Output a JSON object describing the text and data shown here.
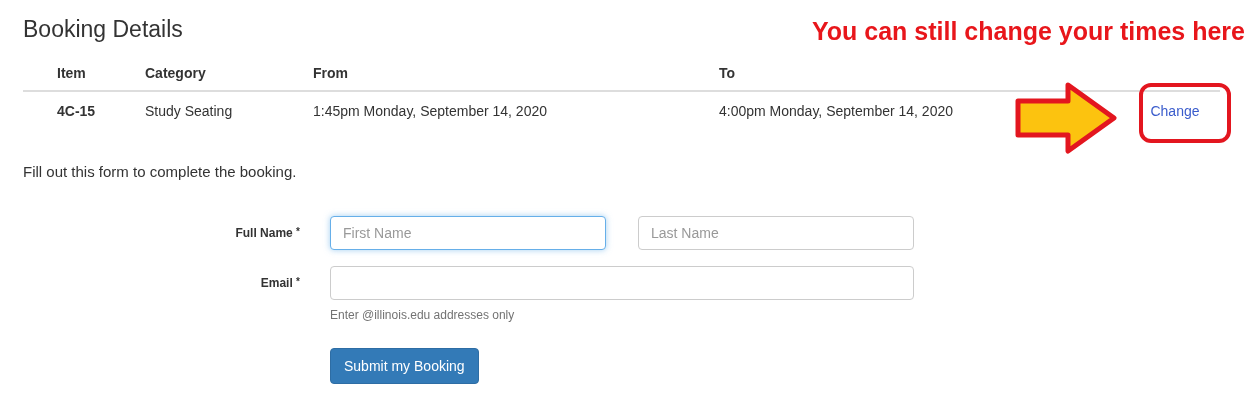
{
  "heading": "Booking Details",
  "annotation": {
    "callout": "You can still change your times here"
  },
  "table": {
    "columns": [
      "Item",
      "Category",
      "From",
      "To"
    ],
    "rows": [
      {
        "cells": [
          "4C-15",
          "Study Seating",
          "1:45pm Monday, September 14, 2020",
          "4:00pm Monday, September 14, 2020"
        ],
        "action": "Change"
      }
    ]
  },
  "intro": "Fill out this form to complete the booking.",
  "form": {
    "fields": [
      {
        "label": "Full Name",
        "required_mark": "*",
        "inputs": [
          {
            "placeholder": "First Name",
            "focused": true
          },
          {
            "placeholder": "Last Name",
            "focused": false
          }
        ]
      },
      {
        "label": "Email",
        "required_mark": "*",
        "inputs": [
          {
            "focused": false
          }
        ],
        "help": "Enter @illinois.edu addresses only"
      }
    ],
    "submit": "Submit my Booking"
  }
}
